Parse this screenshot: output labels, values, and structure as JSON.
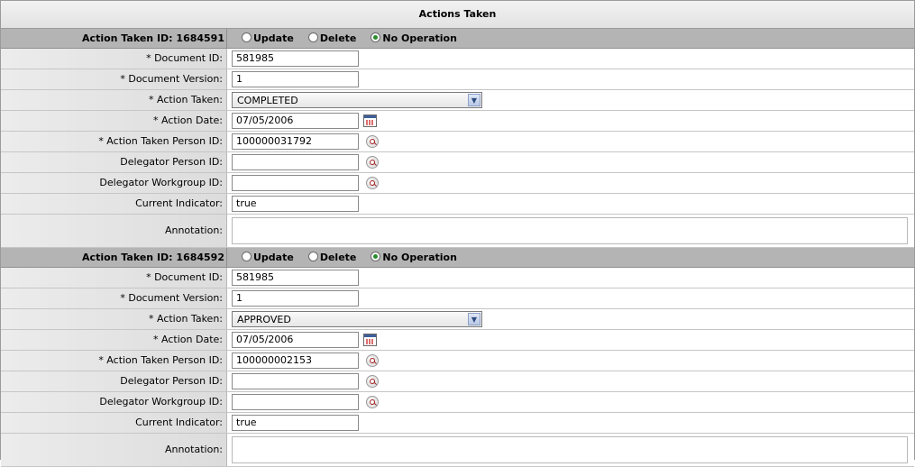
{
  "page": {
    "title": "Actions Taken"
  },
  "radio_labels": {
    "update": "Update",
    "delete": "Delete",
    "no_op": "No Operation"
  },
  "field_labels": {
    "document_id": "* Document ID:",
    "document_version": "* Document Version:",
    "action_taken": "* Action Taken:",
    "action_date": "* Action Date:",
    "action_taken_person_id": "* Action Taken Person ID:",
    "delegator_person_id": "Delegator Person ID:",
    "delegator_workgroup_id": "Delegator Workgroup ID:",
    "current_indicator": "Current Indicator:",
    "annotation": "Annotation:"
  },
  "actions": [
    {
      "header": "Action Taken ID: 1684591",
      "selected_radio": "no_op",
      "document_id": "581985",
      "document_version": "1",
      "action_taken": "COMPLETED",
      "action_date": "07/05/2006",
      "action_taken_person_id": "100000031792",
      "delegator_person_id": "",
      "delegator_workgroup_id": "",
      "current_indicator": "true",
      "annotation": ""
    },
    {
      "header": "Action Taken ID: 1684592",
      "selected_radio": "no_op",
      "document_id": "581985",
      "document_version": "1",
      "action_taken": "APPROVED",
      "action_date": "07/05/2006",
      "action_taken_person_id": "100000002153",
      "delegator_person_id": "",
      "delegator_workgroup_id": "",
      "current_indicator": "true",
      "annotation": ""
    }
  ]
}
